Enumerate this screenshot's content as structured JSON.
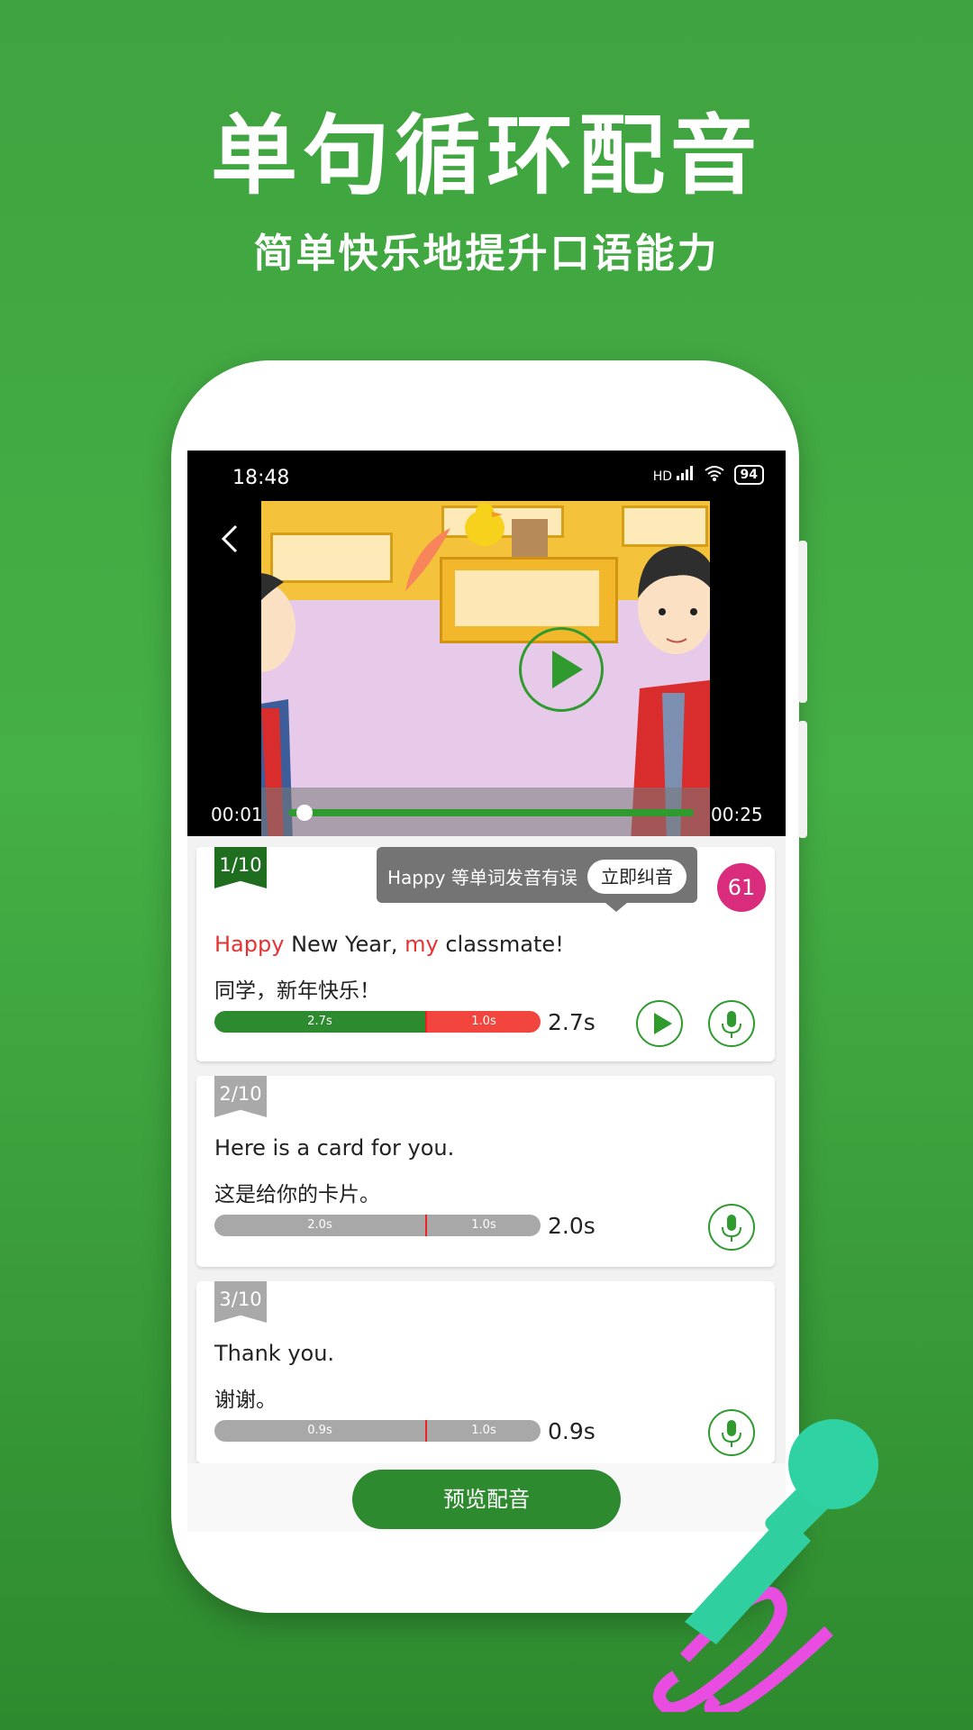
{
  "promo": {
    "headline": "单句循环配音",
    "subline": "简单快乐地提升口语能力"
  },
  "status_bar": {
    "time": "18:48",
    "network": "HD",
    "battery": "94"
  },
  "video": {
    "current_time": "00:01",
    "total_time": "00:25",
    "progress": 0.04
  },
  "tooltip": {
    "text": "Happy 等单词发音有误",
    "button": "立即纠音"
  },
  "cards": [
    {
      "index": "1/10",
      "score": "61",
      "english": {
        "w1": "Happy",
        "w2": " New Year, ",
        "w3": "my",
        "w4": " classmate!"
      },
      "chinese": "同学，新年快乐！",
      "seg1": "2.7s",
      "seg2": "1.0s",
      "duration": "2.7s"
    },
    {
      "index": "2/10",
      "english": "Here is a card for you.",
      "chinese": "这是给你的卡片。",
      "seg1": "2.0s",
      "seg2": "1.0s",
      "duration": "2.0s"
    },
    {
      "index": "3/10",
      "english": "Thank you.",
      "chinese": "谢谢。",
      "seg1": "0.9s",
      "seg2": "1.0s",
      "duration": "0.9s"
    }
  ],
  "bottom": {
    "preview_button": "预览配音"
  },
  "colors": {
    "accent_green": "#2e8a2e",
    "highlight_red": "#e53333",
    "score_pink": "#d92c7c"
  }
}
